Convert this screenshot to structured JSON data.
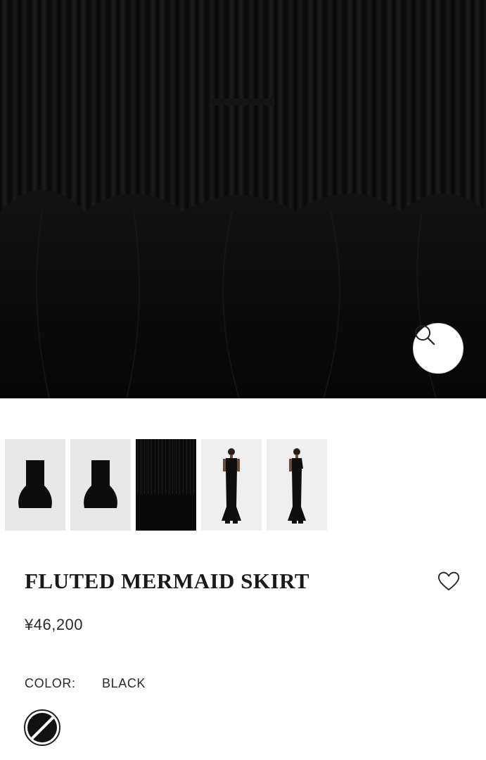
{
  "product": {
    "title": "FLUTED MERMAID SKIRT",
    "price": "¥46,200",
    "color_label": "COLOR:",
    "color_value": "BLACK"
  },
  "gallery": {
    "thumbnails": [
      {
        "view": "flat-front"
      },
      {
        "view": "flat-back"
      },
      {
        "view": "knit-closeup",
        "selected": true
      },
      {
        "view": "model-front"
      },
      {
        "view": "model-side"
      }
    ]
  },
  "icons": {
    "zoom": "magnifier-icon",
    "wishlist": "heart-icon",
    "swatch": "unavailable-swatch"
  },
  "colors": {
    "garment": "#0b0b0b",
    "thumb_bg": "#e8e8e8",
    "text": "#222222"
  }
}
